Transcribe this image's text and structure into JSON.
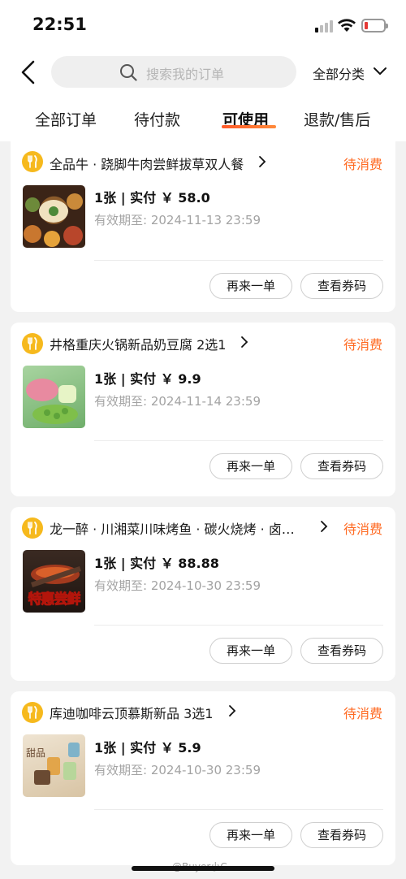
{
  "status_bar": {
    "time": "22:51"
  },
  "header": {
    "search_placeholder": "搜索我的订单",
    "category": "全部分类"
  },
  "tabs": [
    {
      "label": "全部订单",
      "active": false
    },
    {
      "label": "待付款",
      "active": false
    },
    {
      "label": "可使用",
      "active": true
    },
    {
      "label": "退款/售后",
      "active": false
    }
  ],
  "orders": [
    {
      "shop": "全品牛 · 跷脚牛肉尝鲜拔草双人餐",
      "status": "待消费",
      "quantity_price": "1张 | 实付 ￥ 58.0",
      "expiry": "有效期至:  2024-11-13 23:59",
      "reorder_label": "再来一单",
      "view_label": "查看券码"
    },
    {
      "shop": "井格重庆火锅新品奶豆腐 2选1",
      "status": "待消费",
      "quantity_price": "1张 | 实付 ￥ 9.9",
      "expiry": "有效期至:  2024-11-14 23:59",
      "reorder_label": "再来一单",
      "view_label": "查看券码"
    },
    {
      "shop": "龙一醉 · 川湘菜川味烤鱼 · 碳火烧烤 · 卤…",
      "status": "待消费",
      "quantity_price": "1张 | 实付 ￥ 88.88",
      "expiry": "有效期至:  2024-10-30 23:59",
      "thumb_text": "特惠尝鲜",
      "reorder_label": "再来一单",
      "view_label": "查看券码"
    },
    {
      "shop": "库迪咖啡云顶慕斯新品 3选1",
      "status": "待消费",
      "quantity_price": "1张 | 实付 ￥ 5.9",
      "expiry": "有效期至:  2024-10-30 23:59",
      "thumb_text": "甜品",
      "reorder_label": "再来一单",
      "view_label": "查看券码"
    }
  ],
  "watermark": "@Buyer小C",
  "colors": {
    "accent": "#ff6a22",
    "shop_icon": "#f6b91d"
  },
  "icons": [
    "back-icon",
    "search-icon",
    "chevron-down-icon",
    "fork-knife-icon",
    "chevron-right-icon",
    "wifi-icon",
    "battery-icon"
  ]
}
